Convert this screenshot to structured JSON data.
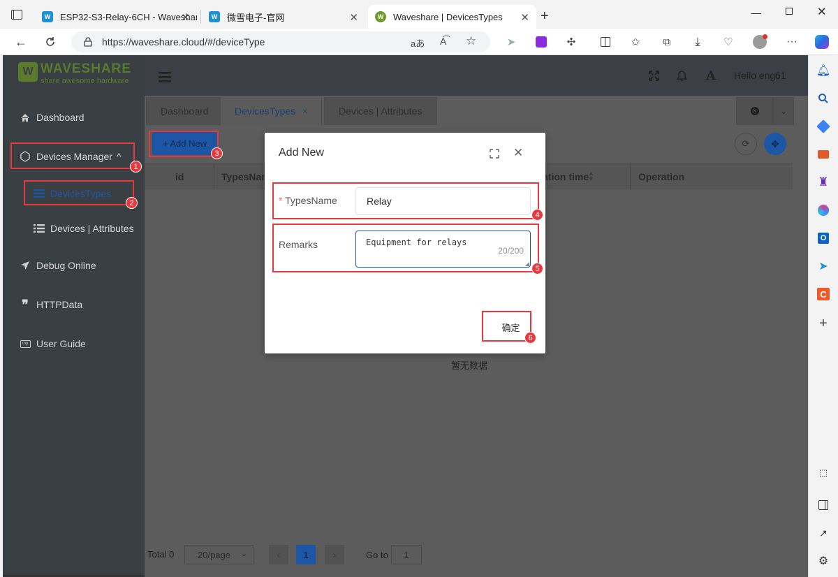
{
  "browser": {
    "tabs": [
      {
        "title": "ESP32-S3-Relay-6CH - Waveshar",
        "favicon": "W"
      },
      {
        "title": "微雪电子-官网",
        "favicon": "W"
      },
      {
        "title": "Waveshare | DevicesTypes",
        "favicon": "W"
      }
    ],
    "url": "https://waveshare.cloud/#/deviceType"
  },
  "app": {
    "logo_text": "WAVESHARE",
    "logo_tagline": "share awesome hardware",
    "greeting": "Hello eng61",
    "sidebar": {
      "dashboard": "Dashboard",
      "devices_manager": "Devices Manager",
      "devices_types": "DevicesTypes",
      "devices_attributes": "Devices | Attributes",
      "debug_online": "Debug Online",
      "http_data": "HTTPData",
      "user_guide": "User Guide"
    },
    "page_tabs": {
      "dashboard": "Dashboard",
      "devices_types": "DevicesTypes",
      "devices_attributes": "Devices | Attributes",
      "close_mark": "×"
    },
    "add_new_button": "+ Add New",
    "table": {
      "col_id": "id",
      "col_types_name": "TypesNam",
      "col_creation_time": "ation time",
      "col_operation": "Operation",
      "empty_text": "暂无数据"
    },
    "pagination": {
      "total": "Total 0",
      "page_size": "20/page",
      "current_page": "1",
      "goto_label": "Go to",
      "goto_value": "1"
    }
  },
  "dialog": {
    "title": "Add New",
    "types_name_label": "TypesName",
    "required_mark": "*",
    "types_name_value": "Relay",
    "remarks_label": "Remarks",
    "remarks_value": "Equipment for relays",
    "remarks_counter": "20/200",
    "confirm_button": "确定"
  },
  "annotations": [
    "1",
    "2",
    "3",
    "4",
    "5",
    "6"
  ],
  "colors": {
    "accent": "#1d56a5",
    "annotation_red": "#e8383d",
    "logo_green": "#5c7a2e",
    "overlay_sidebar": "#3a3f44"
  }
}
